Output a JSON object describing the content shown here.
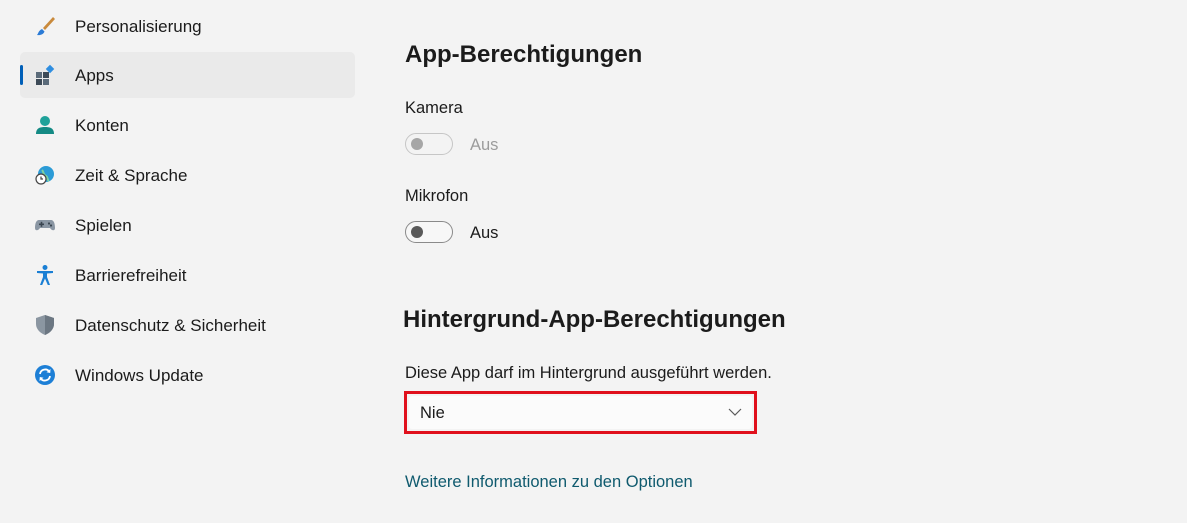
{
  "sidebar": {
    "items": [
      {
        "label": "Personalisierung",
        "icon": "paintbrush-icon"
      },
      {
        "label": "Apps",
        "icon": "apps-icon",
        "selected": true
      },
      {
        "label": "Konten",
        "icon": "person-icon"
      },
      {
        "label": "Zeit & Sprache",
        "icon": "globe-clock-icon"
      },
      {
        "label": "Spielen",
        "icon": "gamepad-icon"
      },
      {
        "label": "Barrierefreiheit",
        "icon": "accessibility-icon"
      },
      {
        "label": "Datenschutz & Sicherheit",
        "icon": "shield-icon"
      },
      {
        "label": "Windows Update",
        "icon": "update-icon"
      }
    ]
  },
  "permissions": {
    "heading": "App-Berechtigungen",
    "camera": {
      "label": "Kamera",
      "state": "Aus",
      "enabled": false
    },
    "microphone": {
      "label": "Mikrofon",
      "state": "Aus",
      "enabled": true
    }
  },
  "background": {
    "heading": "Hintergrund-App-Berechtigungen",
    "description": "Diese App darf im Hintergrund ausgeführt werden.",
    "dropdown_value": "Nie",
    "link": "Weitere Informationen zu den Optionen"
  },
  "colors": {
    "accent": "#005fb8",
    "highlight_border": "#e0101c",
    "link": "#0f5a6e"
  }
}
